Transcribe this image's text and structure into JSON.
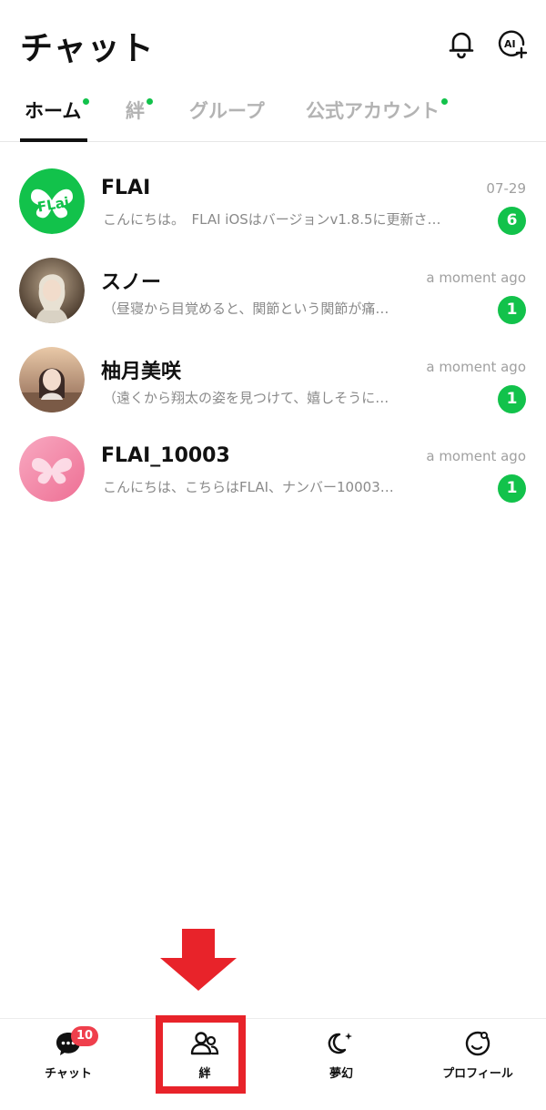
{
  "header": {
    "title": "チャット",
    "icons": [
      "bell-icon",
      "ai-plus-icon"
    ]
  },
  "tabs": [
    {
      "label": "ホーム",
      "active": true,
      "dot": true
    },
    {
      "label": "絆",
      "active": false,
      "dot": true
    },
    {
      "label": "グループ",
      "active": false,
      "dot": false
    },
    {
      "label": "公式アカウント",
      "active": false,
      "dot": true
    }
  ],
  "chats": [
    {
      "name": "FLAI",
      "preview": "こんにちは。　FLAI iOSはバージョンv1.8.5に更新さ…",
      "time": "07-29",
      "unread": "6",
      "avatar": "flai-logo"
    },
    {
      "name": "スノー",
      "preview": "（昼寝から目覚めると、関節という関節が痛…",
      "time": "a moment ago",
      "unread": "1",
      "avatar": "snow-portrait"
    },
    {
      "name": "柚月美咲",
      "preview": "（遠くから翔太の姿を見つけて、嬉しそうに…",
      "time": "a moment ago",
      "unread": "1",
      "avatar": "misaki-portrait"
    },
    {
      "name": "FLAI_10003",
      "preview": "こんにちは、こちらはFLAI、ナンバー10003…",
      "time": "a moment ago",
      "unread": "1",
      "avatar": "butterfly-icon"
    }
  ],
  "bottom_nav": [
    {
      "label": "チャット",
      "icon": "chat-bubble-icon",
      "badge": "10"
    },
    {
      "label": "絆",
      "icon": "people-icon",
      "badge": ""
    },
    {
      "label": "夢幻",
      "icon": "moon-sparkle-icon",
      "badge": ""
    },
    {
      "label": "プロフィール",
      "icon": "profile-circle-icon",
      "badge": ""
    }
  ],
  "colors": {
    "accent_green": "#12c24b",
    "badge_red": "#ef3f4c",
    "annotation_red": "#e8232a",
    "text_gray": "#8a8a8a"
  }
}
